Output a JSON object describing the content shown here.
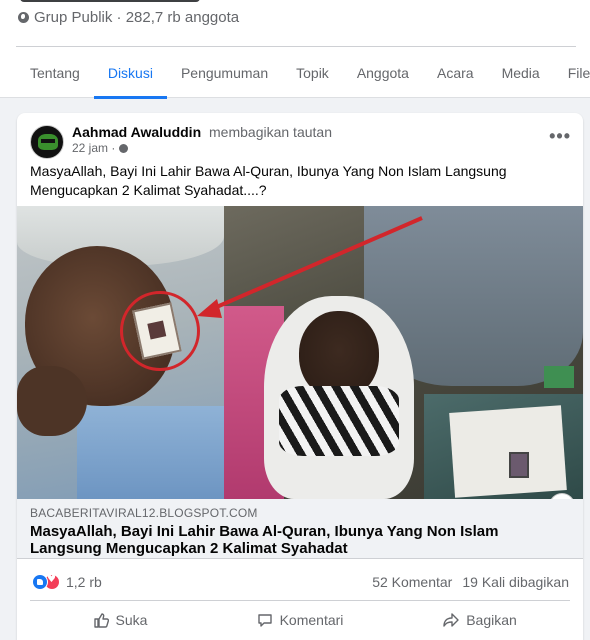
{
  "group": {
    "meta": "Grup Publik · 282,7 rb anggota"
  },
  "tabs": [
    {
      "label": "Tentang",
      "active": false
    },
    {
      "label": "Diskusi",
      "active": true
    },
    {
      "label": "Pengumuman",
      "active": false
    },
    {
      "label": "Topik",
      "active": false
    },
    {
      "label": "Anggota",
      "active": false
    },
    {
      "label": "Acara",
      "active": false
    },
    {
      "label": "Media",
      "active": false
    },
    {
      "label": "File",
      "active": false
    }
  ],
  "post": {
    "author": "Aahmad Awaluddin",
    "action": "membagikan tautan",
    "time": "22 jam ·",
    "more": "•••",
    "text": "MasyaAllah, Bayi Ini Lahir Bawa Al-Quran, Ibunya Yang Non Islam Langsung Mengucapkan 2 Kalimat Syahadat....?",
    "link": {
      "domain": "BACABERITAVIRAL12.BLOGSPOT.COM",
      "title": "MasyaAllah, Bayi Ini Lahir Bawa Al-Quran, Ibunya Yang Non Islam Langsung Mengucapkan 2 Kalimat Syahadat",
      "info": "i"
    },
    "reactions": {
      "count": "1,2 rb",
      "comments": "52 Komentar",
      "shares": "19 Kali dibagikan"
    },
    "actions": {
      "like": "Suka",
      "comment": "Komentari",
      "share": "Bagikan"
    }
  },
  "colors": {
    "accent": "#1877f2",
    "love": "#f33e58",
    "secondary_text": "#65676b",
    "annotation_red": "#d2262b"
  },
  "icons": [
    "globe-icon",
    "more-icon",
    "info-icon",
    "like-reaction-icon",
    "love-reaction-icon",
    "like-icon",
    "comment-icon",
    "share-icon"
  ]
}
